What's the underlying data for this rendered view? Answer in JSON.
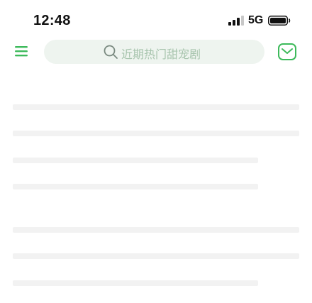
{
  "status_bar": {
    "time": "12:48",
    "network": "5G",
    "icons": [
      "signal-icon",
      "battery-icon"
    ]
  },
  "header": {
    "search": {
      "placeholder": "近期热门甜宠剧"
    },
    "icons": [
      "menu-icon",
      "search-icon",
      "message-icon"
    ]
  },
  "colors": {
    "accent": "#3dba5b",
    "search_background": "#eef4ef",
    "placeholder": "#a7c4ad",
    "skeleton": "#f2f2f2"
  }
}
